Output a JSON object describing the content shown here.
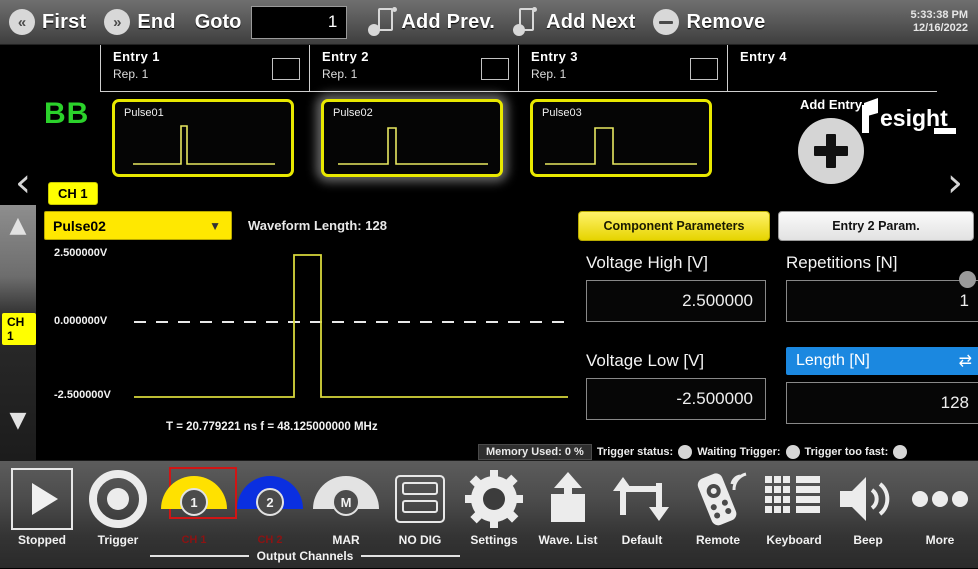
{
  "topbar": {
    "first_label": "First",
    "end_label": "End",
    "goto_label": "Goto",
    "goto_value": "1",
    "add_prev_label": "Add Prev.",
    "add_next_label": "Add Next",
    "remove_label": "Remove",
    "clock_time": "5:33:38 PM",
    "clock_date": "12/16/2022"
  },
  "entry_strip": {
    "bb_logo": "BB",
    "channel_pill": "CH 1",
    "add_entry_label": "Add Entry",
    "brand": "iesight",
    "entries": [
      {
        "title": "Entry  1",
        "rep": "Rep.  1",
        "waveform": "Pulse01",
        "selected": false
      },
      {
        "title": "Entry  2",
        "rep": "Rep.  1",
        "waveform": "Pulse02",
        "selected": true
      },
      {
        "title": "Entry  3",
        "rep": "Rep.  1",
        "waveform": "Pulse03",
        "selected": false
      },
      {
        "title": "Entry  4",
        "rep": "",
        "waveform": "",
        "selected": false
      }
    ]
  },
  "editor": {
    "rail_channel": "CH 1",
    "waveform_selected": "Pulse02",
    "waveform_length_label": "Waveform Length:  128",
    "axis": {
      "top": "2.500000V",
      "mid": "0.000000V",
      "bottom": "-2.500000V"
    },
    "timing": "T =  20.779221 ns   f =  48.125000000 MHz"
  },
  "params": {
    "tab_component": "Component Parameters",
    "tab_entry": "Entry  2  Param.",
    "voltage_high_label": "Voltage High [V]",
    "voltage_high_value": "2.500000",
    "voltage_low_label": "Voltage Low [V]",
    "voltage_low_value": "-2.500000",
    "repetitions_label": "Repetitions [N]",
    "repetitions_value": "1",
    "length_label": "Length [N]",
    "length_value": "128"
  },
  "status": {
    "memory_used": "Memory Used:  0 %",
    "trigger_status_label": "Trigger status:",
    "waiting_trigger_label": "Waiting Trigger:",
    "trigger_too_fast_label": "Trigger too fast:"
  },
  "toolbar": {
    "run_label": "Stopped",
    "trigger_label": "Trigger",
    "ch1_label": "CH 1",
    "ch2_label": "CH 2",
    "mar_knob": "M",
    "mar_label": "MAR",
    "nodig_label": "NO DIG",
    "settings_label": "Settings",
    "wavelist_label": "Wave. List",
    "default_label": "Default",
    "remote_label": "Remote",
    "keyboard_label": "Keyboard",
    "beep_label": "Beep",
    "more_label": "More",
    "output_channels_label": "Output Channels",
    "ch1_number": "1",
    "ch2_number": "2"
  },
  "colors": {
    "accent_yellow": "#ffff00",
    "accent_blue": "#1b88e0",
    "green": "#2bd22b",
    "red": "#d01515"
  }
}
